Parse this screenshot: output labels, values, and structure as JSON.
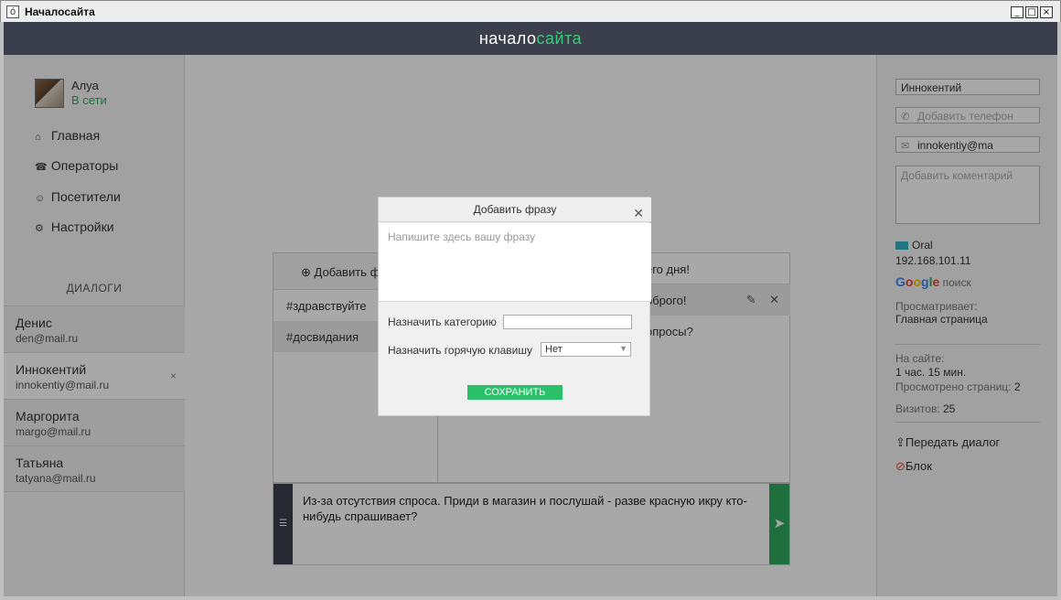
{
  "window": {
    "icon_glyph": "ó",
    "title": "Началосайта",
    "min": "_",
    "max": "□",
    "close": "×"
  },
  "header": {
    "logo_part1": "начало",
    "logo_part2": "сайта"
  },
  "user": {
    "name": "Алуа",
    "status": "В сети"
  },
  "nav": [
    {
      "icon": "home-icon",
      "glyph": "⌂",
      "label": "Главная"
    },
    {
      "icon": "operators-icon",
      "glyph": "☎",
      "label": "Операторы"
    },
    {
      "icon": "visitors-icon",
      "glyph": "☺",
      "label": "Посетители"
    },
    {
      "icon": "settings-icon",
      "glyph": "⚙",
      "label": "Настройки"
    }
  ],
  "dialogs": {
    "header": "ДИАЛОГИ",
    "items": [
      {
        "name": "Денис",
        "email": "den@mail.ru"
      },
      {
        "name": "Иннокентий",
        "email": "innokentiy@mail.ru",
        "close": "×"
      },
      {
        "name": "Маргорита",
        "email": "margo@mail.ru"
      },
      {
        "name": "Татьяна",
        "email": "tatyana@mail.ru"
      }
    ]
  },
  "phrases": {
    "add_label": "⊕  Добавить ф",
    "categories": [
      "#здравствуйте",
      "#досвидания"
    ],
    "texts": [
      "его дня!",
      "оброго!",
      "опросы?"
    ],
    "edit_glyph": "✎",
    "delete_glyph": "✕"
  },
  "composer": {
    "left_glyph": "☰",
    "text": "Из-за отсутствия спроса. Приди в магазин и послушай - разве красную икру кто-нибудь спрашивает?",
    "send_glyph": "➤"
  },
  "visitor": {
    "name_value": "Иннокентий",
    "phone_placeholder": "Добавить телефон",
    "email_value": "innokentiy@ma",
    "comment_placeholder": "Добавить коментарий",
    "country": "Oral",
    "ip": "192.168.101.11",
    "source_logo": "Google",
    "source_word": "поиск",
    "viewing_label": "Просматривает:",
    "viewing_value": "Главная страница",
    "onsite_label": "На сайте:",
    "onsite_value": "1 час. 15 мин.",
    "pages_label": "Просмотрено страниц:",
    "pages_value": "2",
    "visits_label": "Визитов:",
    "visits_value": "25",
    "transfer_label": "Передать диалог",
    "block_label": "Блок"
  },
  "modal": {
    "title": "Добавить фразу",
    "close": "✕",
    "phrase_placeholder": "Напишите здесь вашу фразу",
    "category_label": "Назначить категорию",
    "category_value": "",
    "hotkey_label": "Назначить горячую клавишу",
    "hotkey_value": "Нет",
    "hotkey_arrow": "▼",
    "save_label": "СОХРАНИТЬ"
  },
  "colors": {
    "header_bg": "#3a3f4b",
    "accent_green": "#2bc06a",
    "status_green": "#27ae60"
  }
}
